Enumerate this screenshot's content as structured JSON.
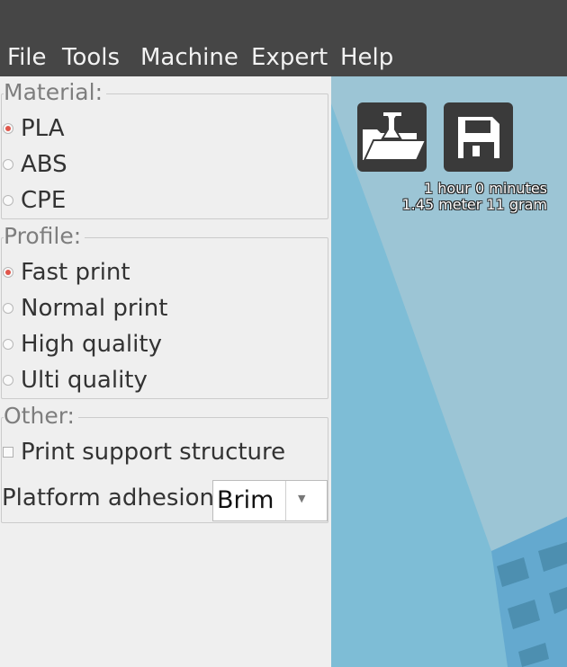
{
  "menu": {
    "file": "File",
    "tools": "Tools",
    "machine": "Machine",
    "expert": "Expert",
    "help": "Help"
  },
  "material": {
    "legend": "Material:",
    "options": [
      {
        "label": "PLA",
        "selected": true
      },
      {
        "label": "ABS",
        "selected": false
      },
      {
        "label": "CPE",
        "selected": false
      }
    ]
  },
  "profile": {
    "legend": "Profile:",
    "options": [
      {
        "label": "Fast print",
        "selected": true
      },
      {
        "label": "Normal print",
        "selected": false
      },
      {
        "label": "High quality",
        "selected": false
      },
      {
        "label": "Ulti quality",
        "selected": false
      }
    ]
  },
  "other": {
    "legend": "Other:",
    "support_label": "Print support structure",
    "support_checked": false,
    "adhesion_label": "Platform adhesion",
    "adhesion_value": "Brim"
  },
  "viewport": {
    "load_icon": "load-model-icon",
    "save_icon": "save-floppy-icon",
    "estimate_time": "1 hour 0 minutes",
    "estimate_material": "1.45 meter 11 gram"
  },
  "colors": {
    "bar": "#464646",
    "panel": "#efefef",
    "accent": "#e0564b",
    "viewport": "#7ebdd6",
    "button": "#3a3a3a"
  }
}
